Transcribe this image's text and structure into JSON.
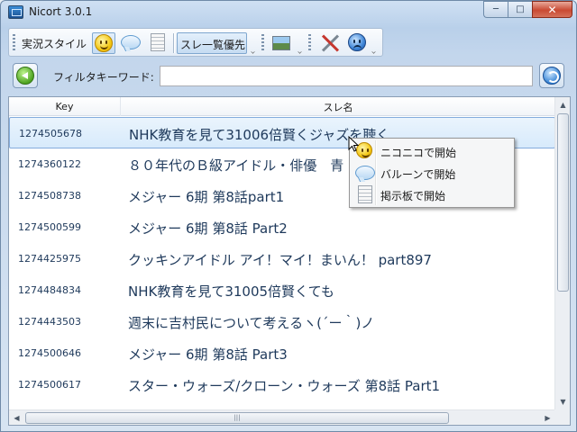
{
  "window": {
    "title": "Nicort 3.0.1",
    "controls": {
      "minimize": "─",
      "maximize": "□",
      "close": "✕"
    }
  },
  "toolbar": {
    "live_style_label": "実況スタイル",
    "thread_priority_label": "スレ一覧優先"
  },
  "filter": {
    "label": "フィルタキーワード:",
    "value": ""
  },
  "table": {
    "columns": {
      "key": "Key",
      "name": "スレ名"
    },
    "rows": [
      {
        "key": "1274505678",
        "name": "NHK教育を見て31006倍賢くジャズを聴く"
      },
      {
        "key": "1274360122",
        "name": "８０年代のＢ級アイドル・俳優　青"
      },
      {
        "key": "1274508738",
        "name": "メジャー 6期 第8話part1"
      },
      {
        "key": "1274500599",
        "name": "メジャー 6期 第8話 Part2"
      },
      {
        "key": "1274425975",
        "name": "クッキンアイドル アイ！マイ！まいん！ part897"
      },
      {
        "key": "1274484834",
        "name": "NHK教育を見て31005倍賢くても"
      },
      {
        "key": "1274443503",
        "name": "週末に吉村民について考えるヽ(´ー｀)ノ"
      },
      {
        "key": "1274500646",
        "name": "メジャー 6期 第8話 Part3"
      },
      {
        "key": "1274500617",
        "name": "スター・ウォーズ/クローン・ウォーズ 第8話 Part1"
      }
    ],
    "selected_row": 0
  },
  "context_menu": {
    "items": [
      {
        "label": "ニコニコで開始",
        "icon": "smiley-icon"
      },
      {
        "label": "バルーンで開始",
        "icon": "balloon-icon"
      },
      {
        "label": "掲示板で開始",
        "icon": "board-icon"
      }
    ]
  },
  "scrollbar": {
    "h_grip": "|||"
  }
}
